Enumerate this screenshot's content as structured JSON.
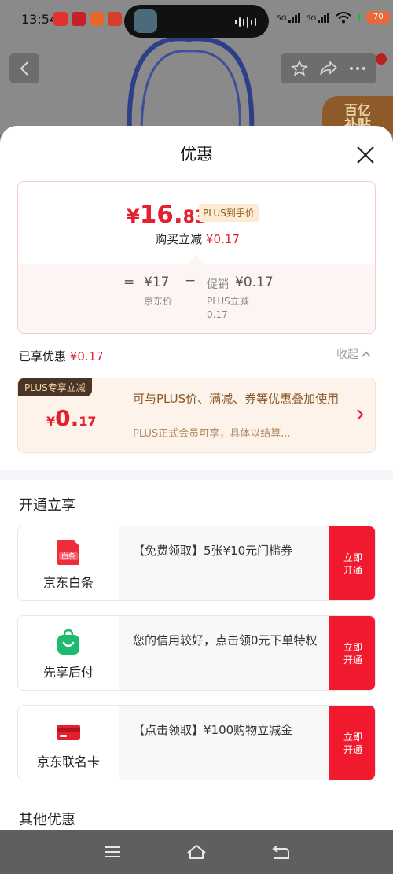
{
  "status_bar": {
    "time": "13:54",
    "battery": "70",
    "network_1": "5G",
    "network_2": "5G"
  },
  "background": {
    "corner_promo": "百亿\n补贴"
  },
  "sheet": {
    "title": "优惠",
    "price_card": {
      "currency": "¥",
      "price_int": "16.",
      "price_dec": "83",
      "plus_tag": "PLUS到手价",
      "reduce_label": "购买立减",
      "reduce_amount": "¥0.17",
      "calc": {
        "equals": "=",
        "jd_price": "¥17",
        "jd_price_label": "京东价",
        "minus": "−",
        "promo_prefix": "促销",
        "promo_amount": "¥0.17",
        "promo_label_1": "PLUS立减",
        "promo_label_2": "0.17"
      }
    },
    "enjoyed": {
      "label": "已享优惠",
      "amount": "¥0.17",
      "collapse_label": "收起"
    },
    "plus_card": {
      "ribbon": "PLUS专享立减",
      "currency": "¥",
      "amount_int": "0.",
      "amount_dec": "17",
      "desc": "可与PLUS价、满减、券等优惠叠加使用",
      "sub": "PLUS正式会员可享，具体以结算..."
    },
    "open_section": {
      "title": "开通立享",
      "items": [
        {
          "name": "京东白条",
          "icon_text": "白条",
          "desc": "【免费领取】5张¥10元门槛券",
          "button": "立即开通"
        },
        {
          "name": "先享后付",
          "icon_text": "",
          "desc": "您的信用较好，点击领0元下单特权",
          "button": "立即开通"
        },
        {
          "name": "京东联名卡",
          "icon_text": "",
          "desc": "【点击领取】¥100购物立减金",
          "button": "立即开通"
        }
      ]
    },
    "other_section": {
      "title": "其他优惠"
    }
  },
  "colors": {
    "accent_red": "#e4202e",
    "button_red": "#f0192d",
    "plus_gold": "#8a5a1c"
  }
}
